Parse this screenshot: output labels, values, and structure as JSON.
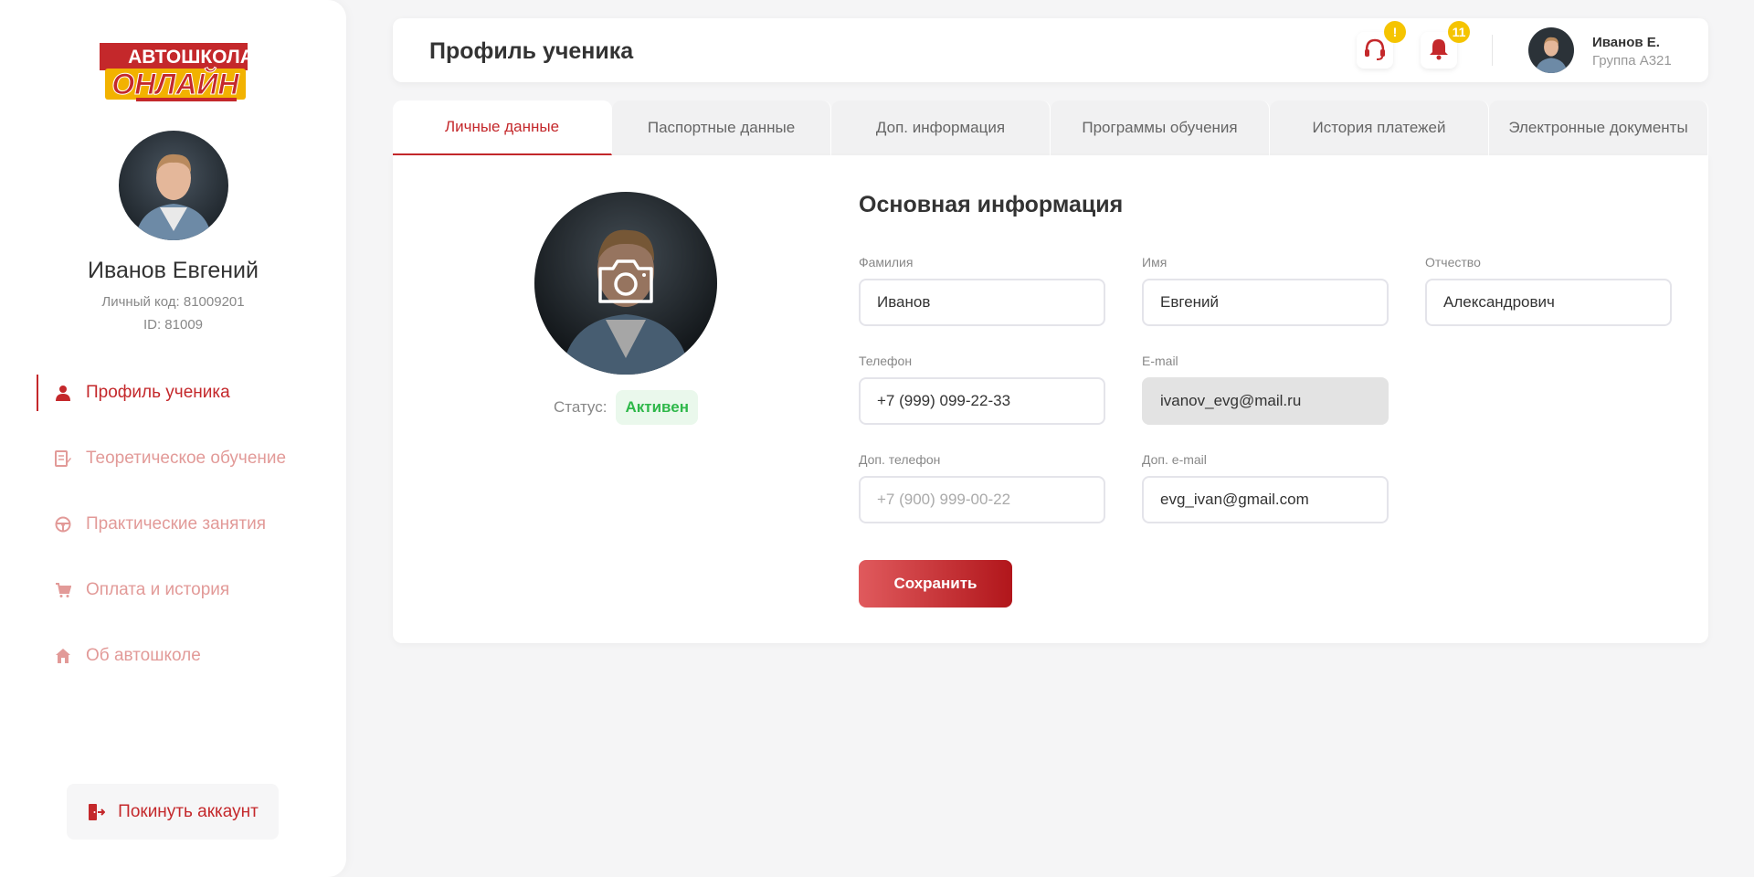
{
  "sidebar": {
    "logo": {
      "line1": "АВТОШКОЛА",
      "line2": "ОНЛАЙН"
    },
    "name": "Иванов Евгений",
    "code": "Личный код: 81009201",
    "id": "ID: 81009",
    "items": [
      {
        "label": "Профиль ученика",
        "icon": "user-icon"
      },
      {
        "label": "Теоретическое обучение",
        "icon": "edit-icon"
      },
      {
        "label": "Практические занятия",
        "icon": "steering-wheel-icon"
      },
      {
        "label": "Оплата и история",
        "icon": "cart-icon"
      },
      {
        "label": "Об автошколе",
        "icon": "home-icon"
      }
    ],
    "logout": "Покинуть аккаунт"
  },
  "header": {
    "title": "Профиль ученика",
    "support_badge": "!",
    "bell_badge": "11",
    "user_name": "Иванов Е.",
    "user_group": "Группа А321"
  },
  "tabs": [
    "Личные данные",
    "Паспортные данные",
    "Доп. информация",
    "Программы обучения",
    "История платежей",
    "Электронные документы"
  ],
  "profile": {
    "status_label": "Статус:",
    "status_value": "Активен",
    "section_title": "Основная информация",
    "fields": {
      "last_name": {
        "label": "Фамилия",
        "value": "Иванов"
      },
      "first_name": {
        "label": "Имя",
        "value": "Евгений"
      },
      "patronymic": {
        "label": "Отчество",
        "value": "Александрович"
      },
      "phone": {
        "label": "Телефон",
        "value": "+7 (999) 099-22-33"
      },
      "email": {
        "label": "E-mail",
        "value": "ivanov_evg@mail.ru"
      },
      "extra_phone": {
        "label": "Доп. телефон",
        "value": "",
        "placeholder": "+7 (900) 999-00-22"
      },
      "extra_email": {
        "label": "Доп. e-mail",
        "value": "evg_ivan@gmail.com"
      }
    },
    "save": "Сохранить"
  },
  "colors": {
    "accent": "#c4282b",
    "accent_light": "#e29a98",
    "badge": "#f5c400",
    "status_green": "#2fb84a"
  }
}
